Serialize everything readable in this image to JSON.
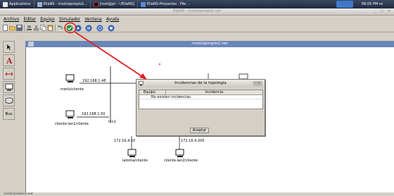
{
  "panel": {
    "applications": "Applications",
    "tasks": [
      "EliaNS - /root/ejemplo2...",
      "[root@pr: ~/EliaNS]",
      "EliaNS-Proyectos - File ..."
    ],
    "clock": "06:05 PM  ro"
  },
  "app": {
    "title": "EliaNS - /root/ejemplo2.net",
    "window_controls": "_ □ ×"
  },
  "menu": [
    "Archivo",
    "Editar",
    "Equipo",
    "Simulador",
    "Ventana",
    "Ayuda"
  ],
  "palette": {
    "bus_label": "Bus"
  },
  "inner_frame": {
    "title": "/root/ejemplo2.net"
  },
  "network": {
    "nodes": [
      {
        "label": "merlo/cliente",
        "ip": "192.168.1.48"
      },
      {
        "label": "cliente-lan1/cliente",
        "ip": "192.168.1.50"
      },
      {
        "label": "latoma/cliente",
        "ip": "172.16.4.10"
      },
      {
        "label": "cliente-lan2/cliente",
        "ip": "172.16.4.200"
      }
    ],
    "lan_label": "lan1"
  },
  "dialog": {
    "title": "Incidencias de la topología",
    "col_equipo": "Equipo",
    "col_incidencia": "Incidencia",
    "row_text": "No existen incidencias",
    "ok_label": "Aceptar"
  },
  "status": {
    "text": "/root/ejemplo2.net"
  },
  "colors": {
    "annotation": "#e02020",
    "frame_title": "#6a86b8"
  }
}
